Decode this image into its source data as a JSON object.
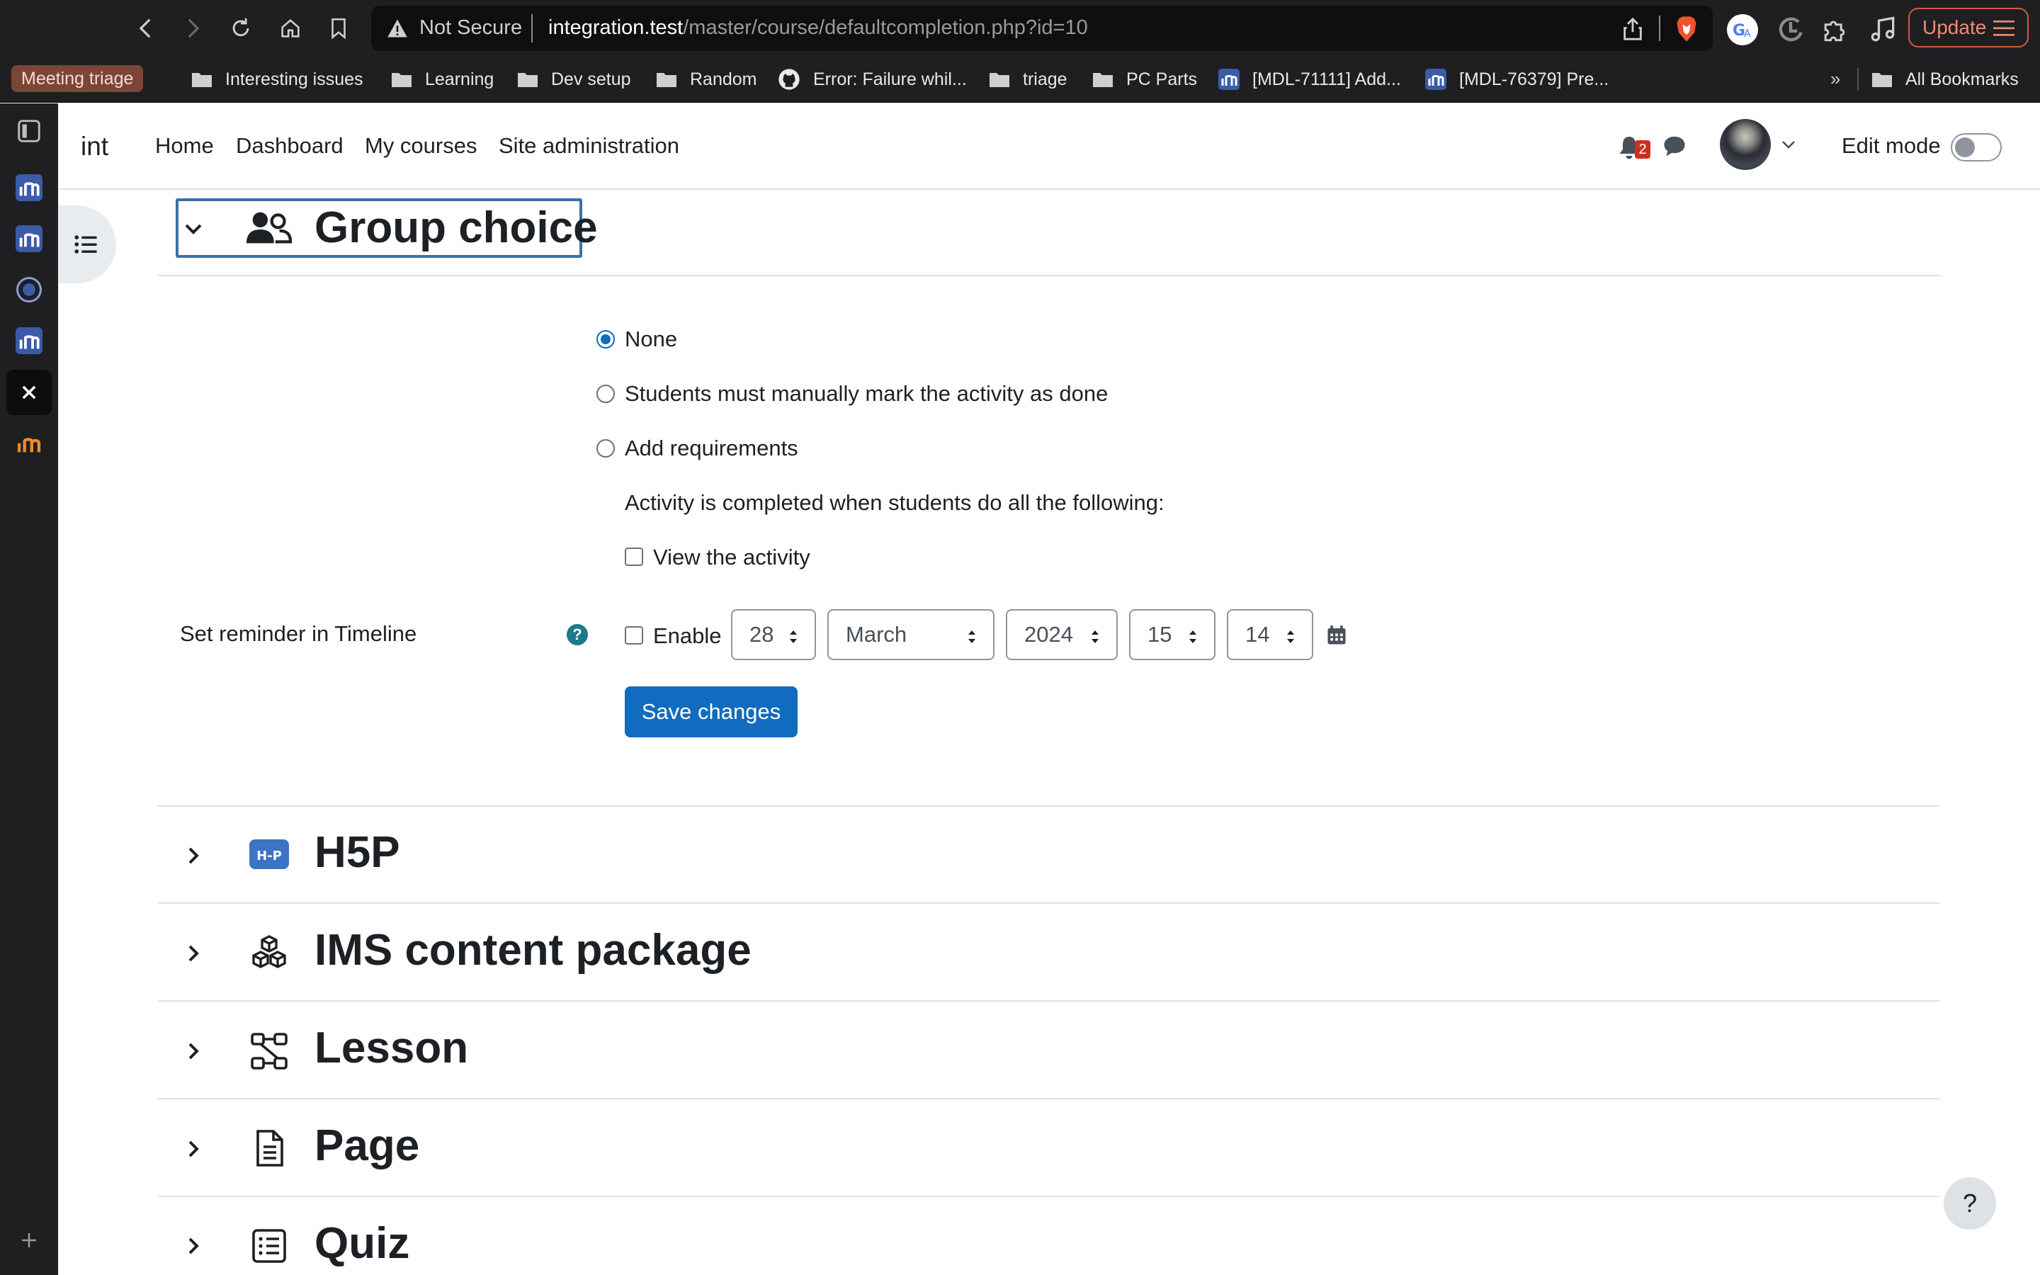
{
  "browser": {
    "security_label": "Not Secure",
    "url_host": "integration.test",
    "url_path": "/master/course/defaultcompletion.php?id=10",
    "update_label": "Update"
  },
  "bookmarks": {
    "pinned": "Meeting triage",
    "items": [
      "Interesting issues",
      "Learning",
      "Dev setup",
      "Random",
      "Error: Failure whil...",
      "triage",
      "PC Parts",
      "[MDL-71111] Add...",
      "[MDL-76379] Pre..."
    ],
    "more": "»",
    "all": "All Bookmarks"
  },
  "moodle": {
    "brand": "int",
    "nav": [
      "Home",
      "Dashboard",
      "My courses",
      "Site administration"
    ],
    "notification_count": "2",
    "edit_mode_label": "Edit mode",
    "edit_mode_on": false
  },
  "group_choice": {
    "title": "Group choice",
    "options": [
      "None",
      "Students must manually mark the activity as done",
      "Add requirements"
    ],
    "selected_option": "None",
    "requirements_text": "Activity is completed when students do all the following:",
    "view_activity_label": "View the activity",
    "reminder_label": "Set reminder in Timeline",
    "help_glyph": "?",
    "enable_label": "Enable",
    "day": "28",
    "month": "March",
    "year": "2024",
    "hour": "15",
    "minute": "14",
    "save_label": "Save changes"
  },
  "sections": [
    "H5P",
    "IMS content package",
    "Lesson",
    "Page",
    "Quiz"
  ],
  "h5p_badge": "H-P",
  "help_button_glyph": "?",
  "colors": {
    "primary": "#0f6cbf",
    "badge": "#ca3120",
    "help": "#1b7a8c"
  }
}
